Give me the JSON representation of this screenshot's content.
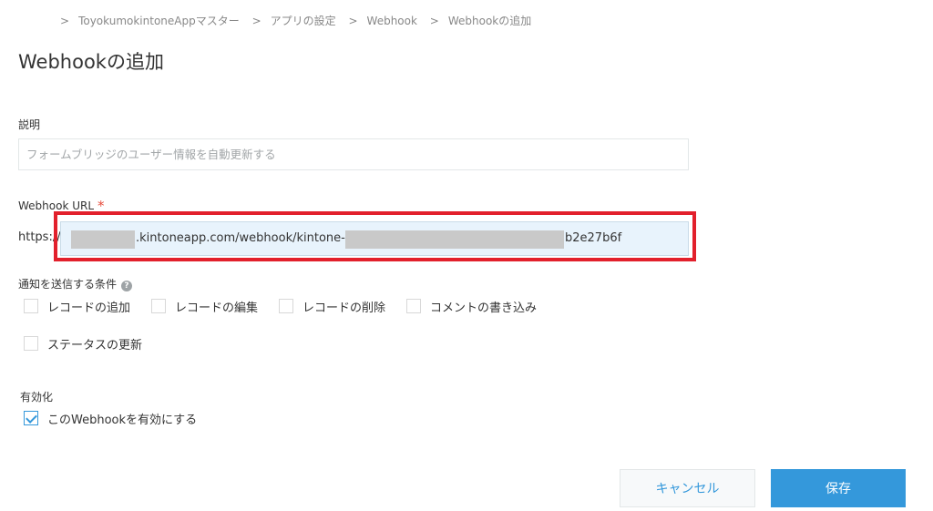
{
  "breadcrumb": [
    {
      "label": "ToyokumokintoneAppマスター"
    },
    {
      "label": "アプリの設定"
    },
    {
      "label": "Webhook"
    },
    {
      "label": "Webhookの追加"
    }
  ],
  "breadcrumb_separator": ">",
  "page_title": "Webhookの追加",
  "description": {
    "label": "説明",
    "placeholder": "フォームブリッジのユーザー情報を自動更新する",
    "value": ""
  },
  "webhook_url": {
    "label": "Webhook URL",
    "required_mark": "*",
    "prefix": "https://",
    "value_part1": ".kintoneapp.com/webhook/kintone-s",
    "value_part2": "b2e27b6f"
  },
  "conditions": {
    "label": "通知を送信する条件",
    "help_icon": "?",
    "options": [
      {
        "label": "レコードの追加",
        "checked": false
      },
      {
        "label": "レコードの編集",
        "checked": false
      },
      {
        "label": "レコードの削除",
        "checked": false
      },
      {
        "label": "コメントの書き込み",
        "checked": false
      },
      {
        "label": "ステータスの更新",
        "checked": false
      }
    ]
  },
  "enable": {
    "label": "有効化",
    "option_label": "このWebhookを有効にする",
    "checked": true
  },
  "buttons": {
    "cancel": "キャンセル",
    "save": "保存"
  },
  "colors": {
    "accent": "#3498db",
    "highlight": "#e2202c",
    "url_field_bg": "#e8f3fc"
  }
}
